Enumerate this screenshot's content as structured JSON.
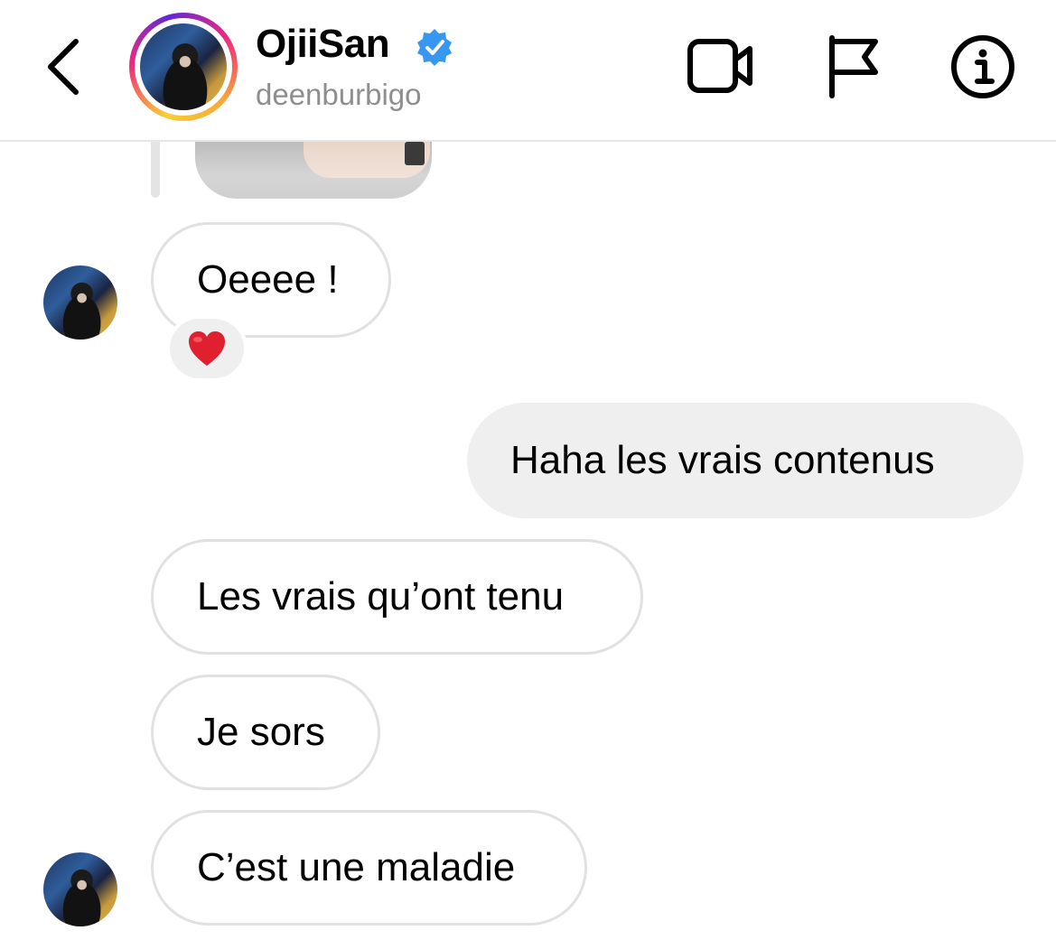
{
  "header": {
    "display_name": "OjiiSan",
    "username": "deenburbigo",
    "verified": true,
    "icons": [
      "back-chevron-icon",
      "video-call-icon",
      "flag-icon",
      "info-icon"
    ]
  },
  "messages": [
    {
      "sender": "them",
      "text": "Oeeee !",
      "reaction": "❤️"
    },
    {
      "sender": "me",
      "text": "Haha les vrais contenus"
    },
    {
      "sender": "them",
      "text": "Les vrais qu’ont tenu"
    },
    {
      "sender": "them",
      "text": "Je sors"
    },
    {
      "sender": "them",
      "text": "C’est une maladie"
    }
  ],
  "colors": {
    "verified_blue": "#3897f0",
    "outgoing_bubble": "#efefef",
    "incoming_border": "#e1e1e1",
    "reaction_heart": "#e0202f",
    "username_gray": "#8e8e8e"
  }
}
